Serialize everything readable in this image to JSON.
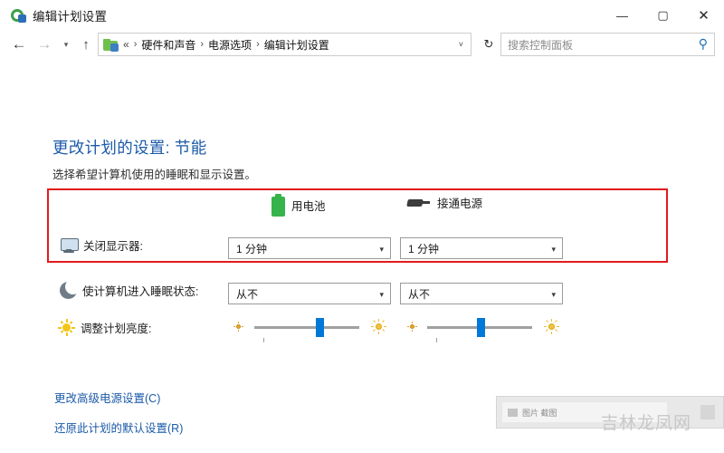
{
  "window": {
    "title": "编辑计划设置",
    "icon": "power-options-icon",
    "buttons": {
      "minimize": "—",
      "maximize": "▢",
      "close": "✕"
    }
  },
  "addressbar": {
    "back": "←",
    "forward": "→",
    "recent": "▾",
    "up": "↑",
    "path_icon": "control-panel-folder-icon",
    "crumbs": [
      "«",
      "硬件和声音",
      "电源选项",
      "编辑计划设置"
    ],
    "separator": "›",
    "dropdown_caret": "˅",
    "refresh": "↻",
    "search_placeholder": "搜索控制面板",
    "search_value": "",
    "search_icon": "magnifier-icon"
  },
  "main": {
    "heading": "更改计划的设置: 节能",
    "subheading": "选择希望计算机使用的睡眠和显示设置。",
    "columns": [
      {
        "label": "用电池",
        "icon": "battery-icon"
      },
      {
        "label": "接通电源",
        "icon": "power-plug-icon"
      }
    ],
    "rows": [
      {
        "label": "关闭显示器:",
        "icon": "monitor-icon",
        "battery_value": "1 分钟",
        "plugged_value": "1 分钟"
      },
      {
        "label": "使计算机进入睡眠状态:",
        "icon": "moon-sleep-icon",
        "battery_value": "从不",
        "plugged_value": "从不"
      }
    ],
    "brightness": {
      "label": "调整计划亮度:",
      "icon": "sun-brightness-icon",
      "battery_percent": 62,
      "plugged_percent": 52,
      "low_icon": "sun-small-icon",
      "high_icon": "sun-large-icon"
    },
    "links": [
      "更改高级电源设置(C)",
      "还原此计划的默认设置(R)"
    ],
    "highlight_color": "#e21b1b",
    "accent_color": "#0078d7",
    "link_color": "#1b5aa8"
  },
  "bottom": {
    "panel_icon": "image-thumb-icon",
    "panel_text": "图片 截图",
    "watermark": "吉林龙凤网"
  }
}
